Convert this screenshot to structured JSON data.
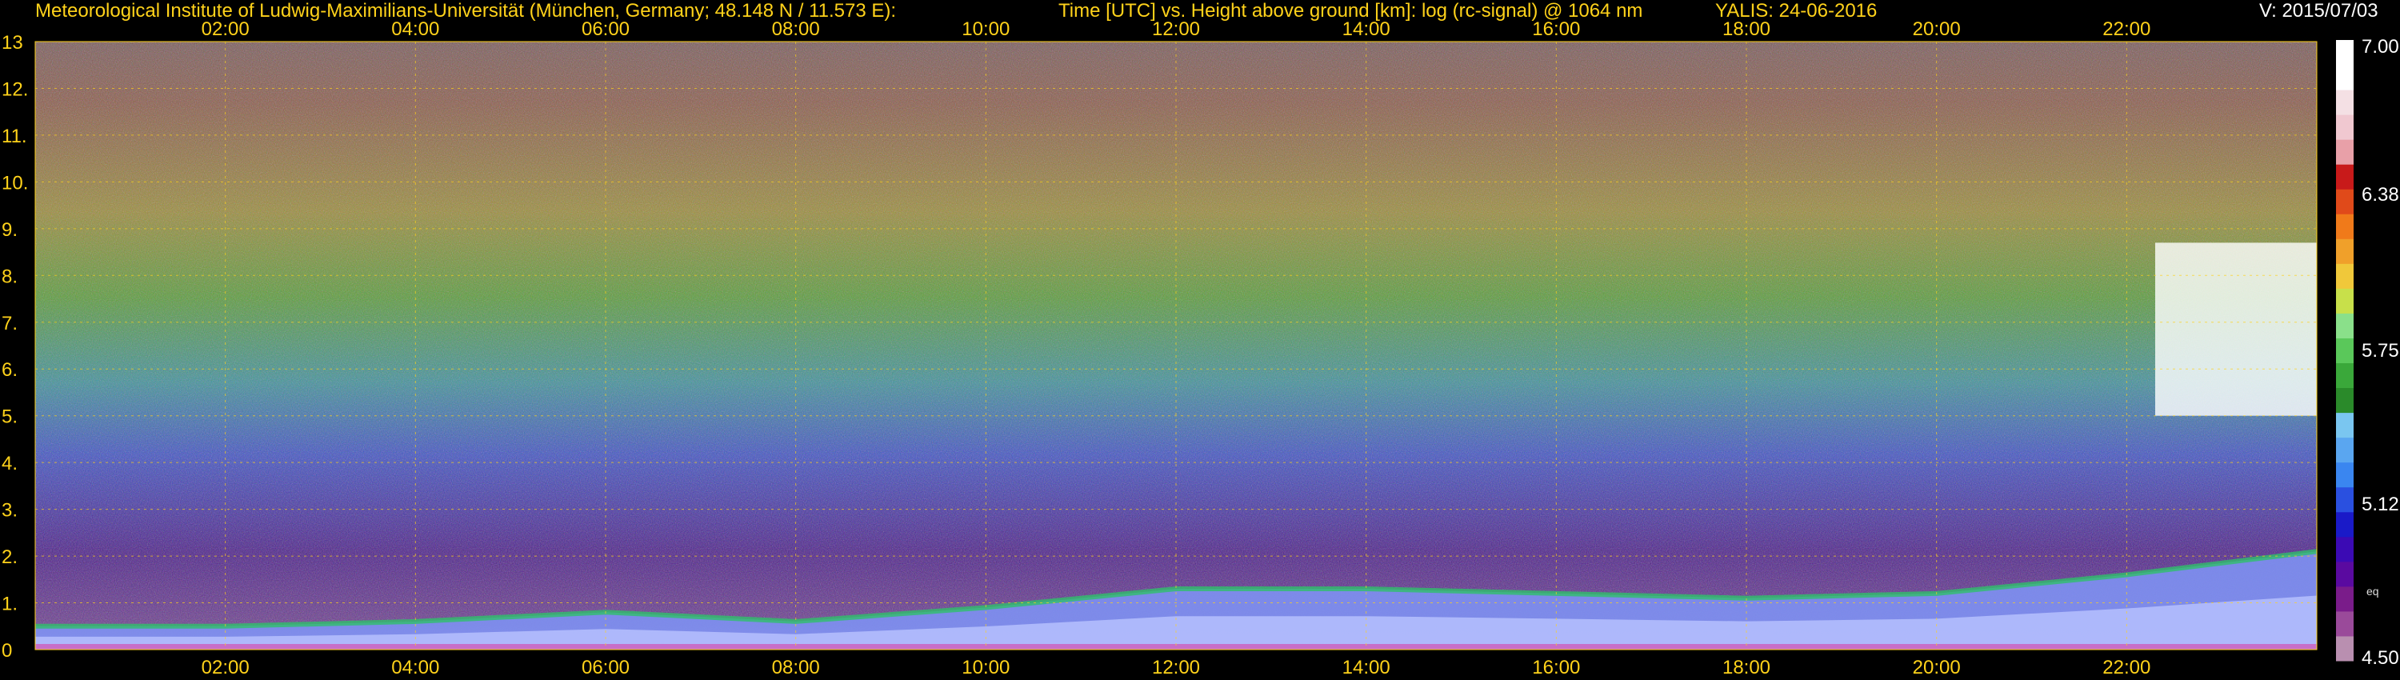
{
  "header": {
    "institute": "Meteorological Institute of Ludwig-Maximilians-Universität (München, Germany; 48.148 N / 11.573 E):",
    "plot_title": "Time [UTC] vs. Height above ground [km]: log (rc-signal) @ 1064 nm",
    "instrument": "YALIS: 24-06-2016",
    "version": "V: 2015/07/03"
  },
  "colors": {
    "text": "#ffd21a",
    "grid": "#ffd21a",
    "background": "#000000"
  },
  "chart_data": {
    "type": "heatmap",
    "title": "Time [UTC] vs. Height above ground [km]: log (rc-signal) @ 1064 nm",
    "xlabel": "Time [UTC]",
    "ylabel": "Height above ground [km]",
    "x_ticks": [
      "02:00",
      "04:00",
      "06:00",
      "08:00",
      "10:00",
      "12:00",
      "14:00",
      "16:00",
      "18:00",
      "20:00",
      "22:00"
    ],
    "x_tick_hours": [
      2,
      4,
      6,
      8,
      10,
      12,
      14,
      16,
      18,
      20,
      22
    ],
    "xlim": [
      0,
      24
    ],
    "y_ticks": [
      "0",
      "1.",
      "2.",
      "3.",
      "4.",
      "5.",
      "6.",
      "7.",
      "8.",
      "9.",
      "10.",
      "11.",
      "12.",
      "13"
    ],
    "ylim": [
      0,
      13
    ],
    "grid": true,
    "colorbar": {
      "labels": [
        "7.00",
        "6.38",
        "5.75",
        "5.12",
        "4.50"
      ],
      "range": [
        4.5,
        7.0
      ],
      "eq_label": "eq"
    },
    "boundary_layer_top_km": {
      "hours": [
        0,
        2,
        4,
        6,
        8,
        10,
        12,
        14,
        16,
        18,
        20,
        22,
        24
      ],
      "values": [
        0.5,
        0.5,
        0.6,
        0.8,
        0.6,
        0.9,
        1.3,
        1.3,
        1.2,
        1.1,
        1.2,
        1.6,
        2.1
      ]
    },
    "cloud": {
      "hours": [
        22.3,
        24
      ],
      "base_km": 5.0,
      "top_km": 8.7
    }
  }
}
